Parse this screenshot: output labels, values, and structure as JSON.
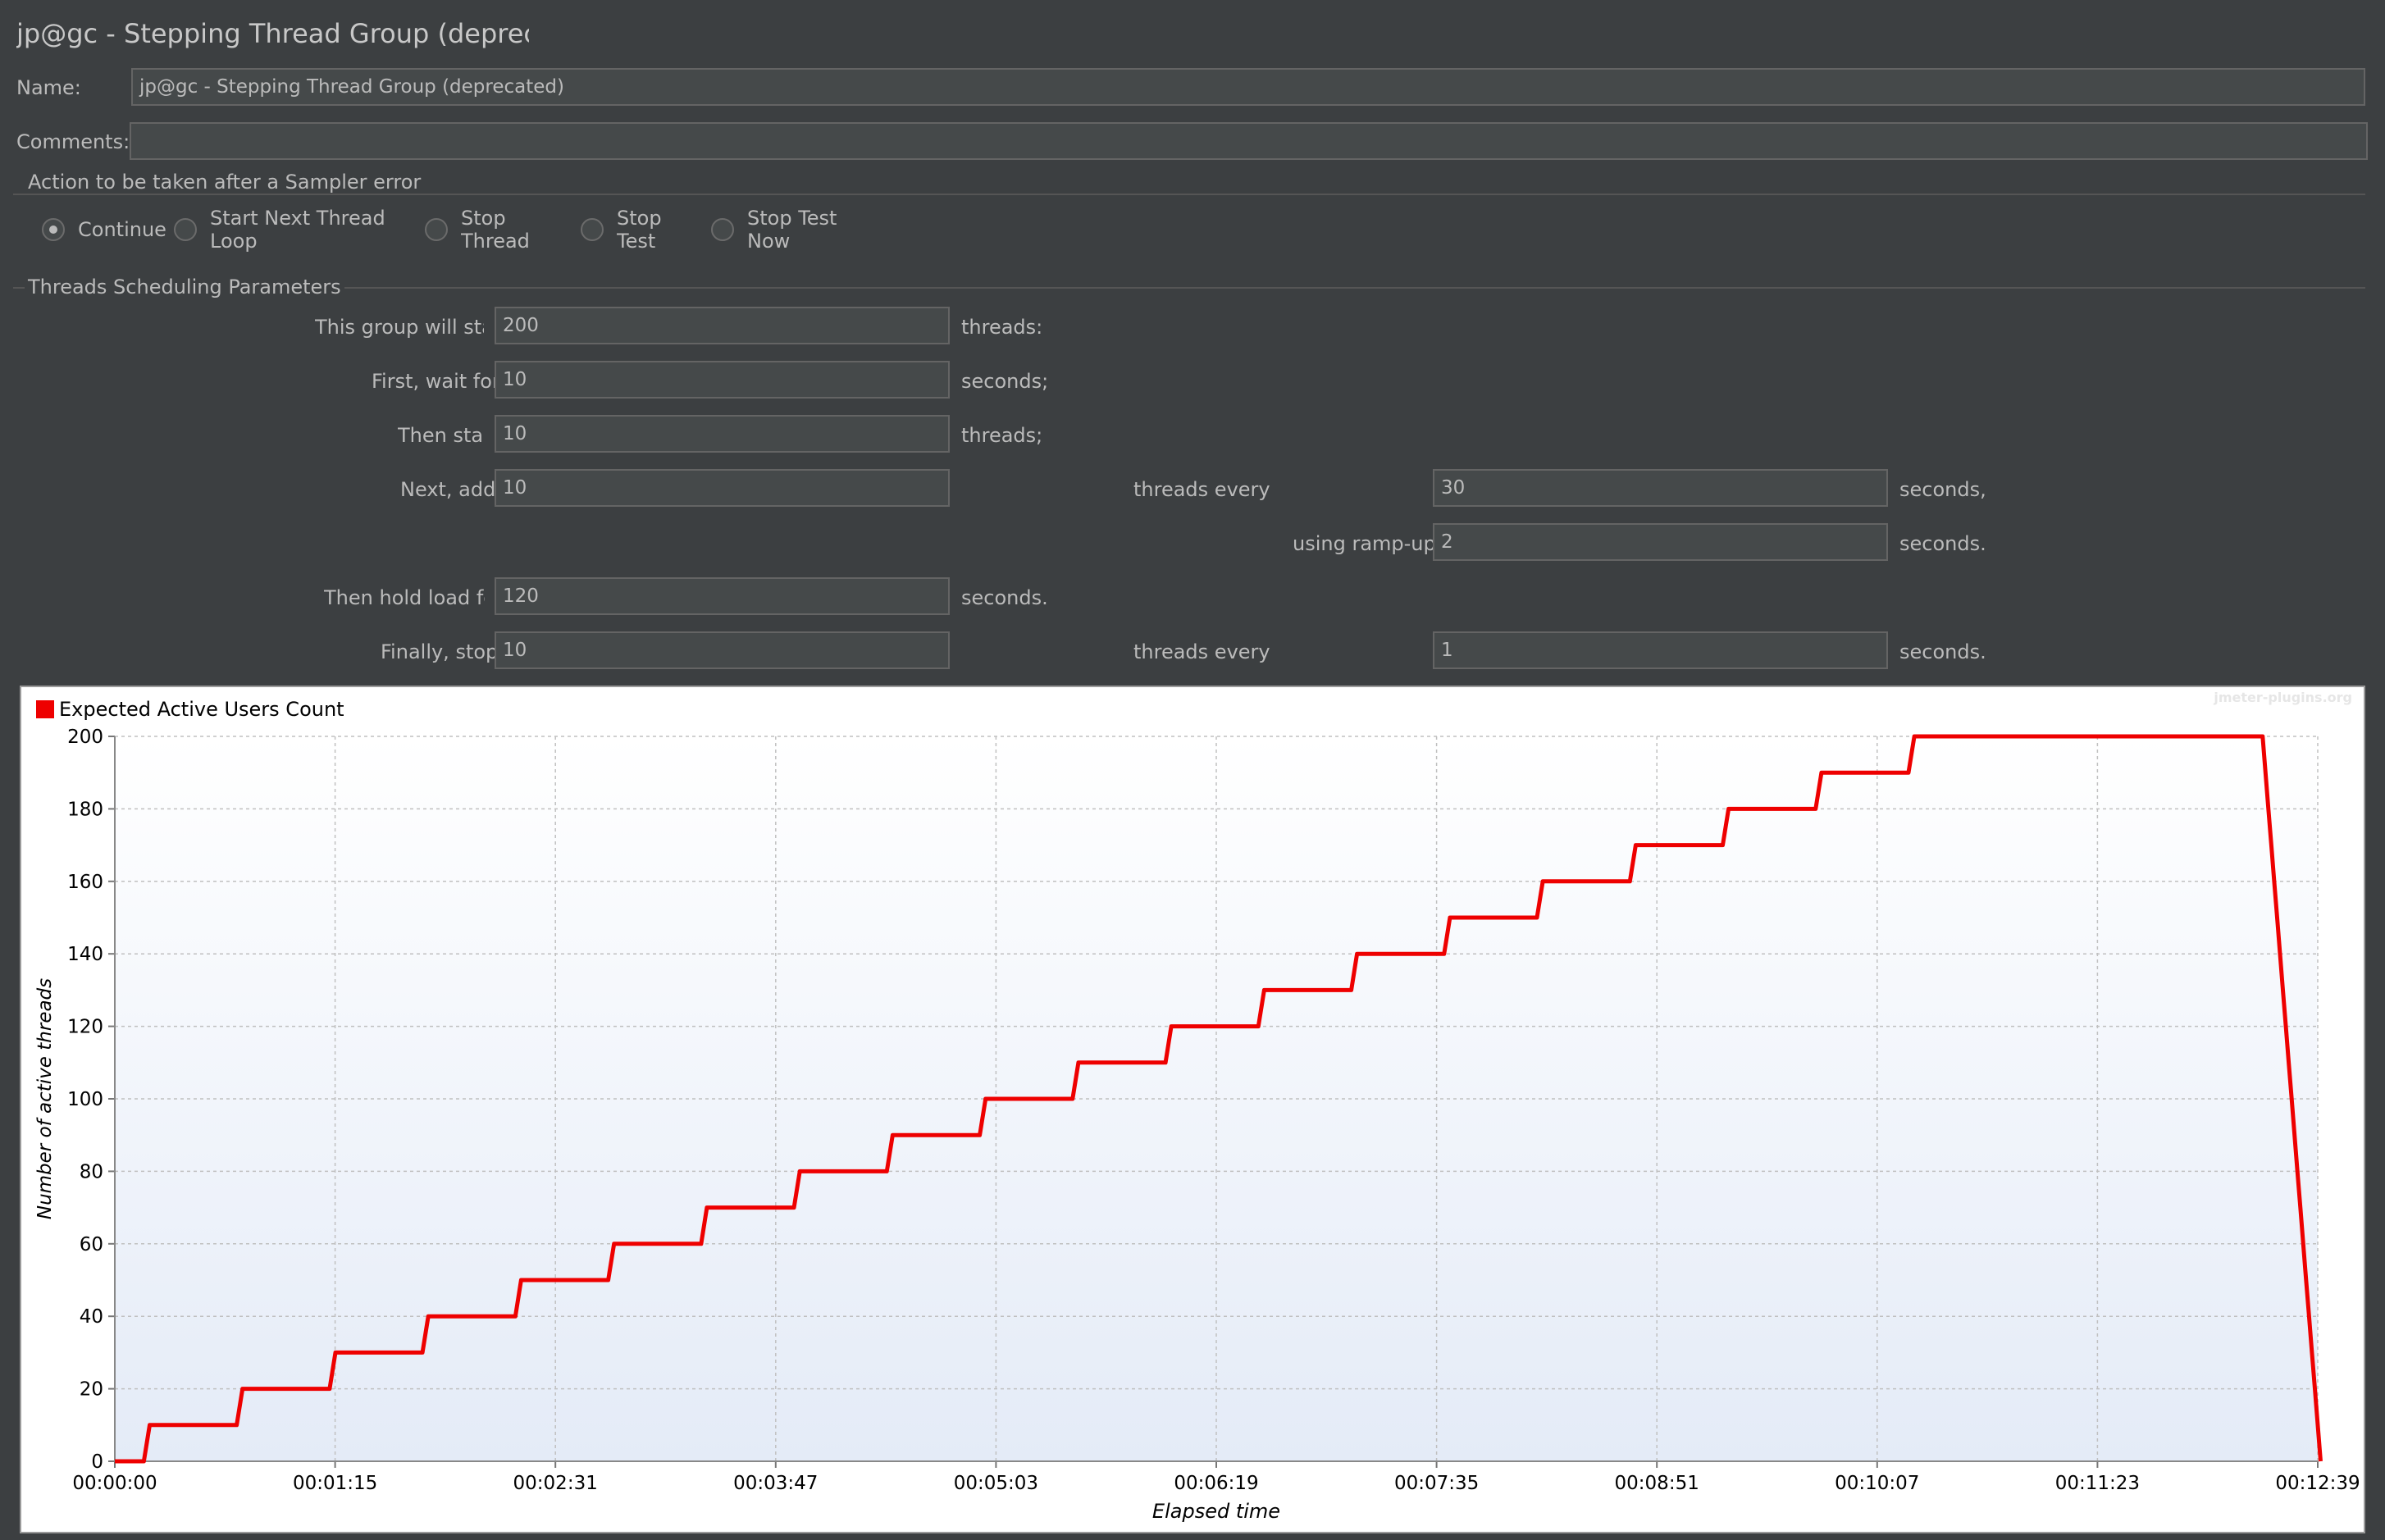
{
  "window": {
    "title": "jp@gc - Stepping Thread Group (deprecated)"
  },
  "name": {
    "label": "Name:",
    "value": "jp@gc - Stepping Thread Group (deprecated)"
  },
  "comments": {
    "label": "Comments:",
    "value": ""
  },
  "sampler_error": {
    "title": "Action to be taken after a Sampler error",
    "options": [
      {
        "label": "Continue",
        "selected": true
      },
      {
        "label": "Start Next Thread Loop",
        "selected": false
      },
      {
        "label": "Stop Thread",
        "selected": false
      },
      {
        "label": "Stop Test",
        "selected": false
      },
      {
        "label": "Stop Test Now",
        "selected": false
      }
    ]
  },
  "scheduling": {
    "title": "Threads Scheduling Parameters",
    "start_label": "This group will start",
    "start_value": "200",
    "start_suffix": "threads:",
    "wait_label": "First, wait for",
    "wait_value": "10",
    "wait_suffix": "seconds;",
    "then_start_label": "Then start",
    "then_start_value": "10",
    "then_start_suffix": "threads;",
    "add_label": "Next, add",
    "add_value": "10",
    "add_every_label": "threads every",
    "add_every_value": "30",
    "add_every_suffix": "seconds,",
    "rampup_label": "using ramp-up",
    "rampup_value": "2",
    "rampup_suffix": "seconds.",
    "hold_label": "Then hold load for",
    "hold_value": "120",
    "hold_suffix": "seconds.",
    "stop_label": "Finally, stop",
    "stop_value": "10",
    "stop_every_label": "threads every",
    "stop_every_value": "1",
    "stop_every_suffix": "seconds."
  },
  "watermark": "jmeter-plugins.org",
  "chart_data": {
    "type": "line",
    "legend": "Expected Active Users Count",
    "legend_placement": "top-left",
    "xlabel": "Elapsed time",
    "ylabel": "Number of active threads",
    "ylim": [
      0,
      200
    ],
    "xlim_seconds": [
      0,
      759
    ],
    "y_ticks": [
      0,
      20,
      40,
      60,
      80,
      100,
      120,
      140,
      160,
      180,
      200
    ],
    "x_tick_labels": [
      "00:00:00",
      "00:01:15",
      "00:02:31",
      "00:03:47",
      "00:05:03",
      "00:06:19",
      "00:07:35",
      "00:08:51",
      "00:10:07",
      "00:11:23",
      "00:12:39"
    ],
    "grid": true,
    "series_color": "#ee0000",
    "series": [
      {
        "name": "Expected Active Users Count",
        "x_seconds": [
          0,
          10,
          12,
          42,
          44,
          74,
          76,
          106,
          108,
          138,
          140,
          170,
          172,
          202,
          204,
          234,
          236,
          266,
          268,
          298,
          300,
          330,
          332,
          362,
          364,
          394,
          396,
          426,
          428,
          458,
          460,
          490,
          492,
          522,
          524,
          554,
          556,
          586,
          588,
          618,
          620,
          740,
          741,
          742,
          743,
          744,
          745,
          746,
          747,
          748,
          749,
          750,
          751,
          752,
          753,
          754,
          755,
          756,
          757,
          758,
          759,
          760
        ],
        "y": [
          0,
          0,
          10,
          10,
          20,
          20,
          30,
          30,
          40,
          40,
          50,
          50,
          60,
          60,
          70,
          70,
          80,
          80,
          90,
          90,
          100,
          100,
          110,
          110,
          120,
          120,
          130,
          130,
          140,
          140,
          150,
          150,
          160,
          160,
          170,
          170,
          180,
          180,
          190,
          190,
          200,
          200,
          190,
          180,
          170,
          160,
          150,
          140,
          130,
          120,
          110,
          100,
          90,
          80,
          70,
          60,
          50,
          40,
          30,
          20,
          10,
          0
        ]
      }
    ]
  }
}
